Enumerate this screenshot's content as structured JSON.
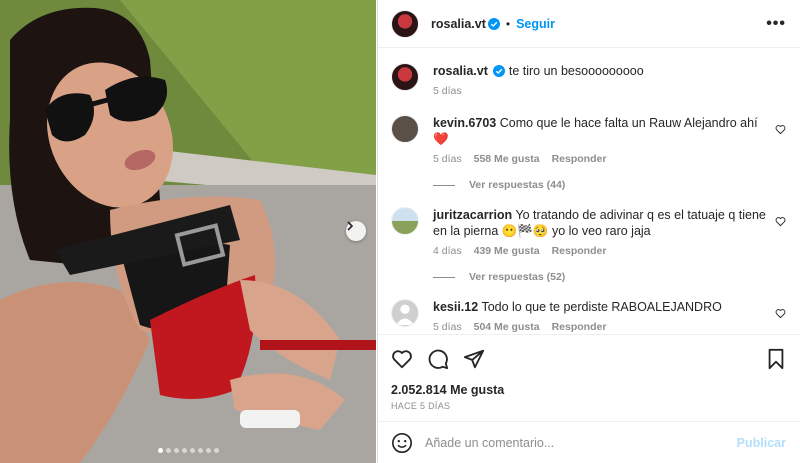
{
  "post": {
    "username": "rosalia.vt",
    "follow_label": "Seguir",
    "separator": "•",
    "more": "•••",
    "caption": "te tiro un besooooooooo",
    "caption_age": "5 días"
  },
  "photo": {
    "carousel_dots": 8,
    "active_dot": 0
  },
  "comments": [
    {
      "username": "kevin.6703",
      "text": "Como que le hace falta un Rauw Alejandro ahí ❤️",
      "age": "5 días",
      "likes": "558 Me gusta",
      "reply": "Responder",
      "view_replies": "Ver respuestas (44)"
    },
    {
      "username": "juritzacarrion",
      "text": "Yo tratando de adivinar q es el tatuaje q tiene en la pierna 😶🏁🥺 yo lo veo raro jaja",
      "age": "4 días",
      "likes": "439 Me gusta",
      "reply": "Responder",
      "view_replies": "Ver respuestas (52)"
    },
    {
      "username": "kesii.12",
      "text": "Todo lo que te perdiste RABOALEJANDRO",
      "age": "5 días",
      "likes": "504 Me gusta",
      "reply": "Responder"
    }
  ],
  "actions": {
    "likes": "2.052.814 Me gusta",
    "time_ago": "HACE 5 DÍAS"
  },
  "composer": {
    "placeholder": "Añade un comentario...",
    "publish_label": "Publicar"
  },
  "colors": {
    "accent": "#0095f6",
    "verified": "#0095f6",
    "shorts_red": "#c0181e"
  }
}
